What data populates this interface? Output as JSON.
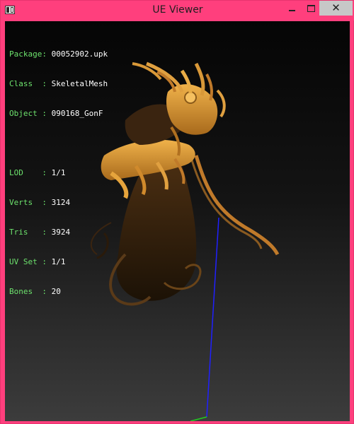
{
  "window": {
    "title": "UE Viewer",
    "icon": "app-window-icon",
    "controls": {
      "minimize": "minimize-icon",
      "maximize": "maximize-icon",
      "close": "✕"
    }
  },
  "info": {
    "package": {
      "label": "Package:",
      "value": "00052902.upk"
    },
    "class": {
      "label": "Class  :",
      "value": "SkeletalMesh"
    },
    "object": {
      "label": "Object :",
      "value": "090168_GonF"
    }
  },
  "stats": {
    "lod": {
      "label": "LOD    :",
      "value": "1/1"
    },
    "verts": {
      "label": "Verts  :",
      "value": "3124"
    },
    "tris": {
      "label": "Tris   :",
      "value": "3924"
    },
    "uvset": {
      "label": "UV Set :",
      "value": "1/1"
    },
    "bones": {
      "label": "Bones  :",
      "value": "20"
    }
  },
  "colors": {
    "titlebar": "#ff3f7d",
    "label_text": "#6de26d",
    "value_text": "#ffffff",
    "axis_z": "#2020ff",
    "axis_y": "#22cc22",
    "mesh_gold": "#d9962e",
    "mesh_dark": "#3a2410"
  }
}
